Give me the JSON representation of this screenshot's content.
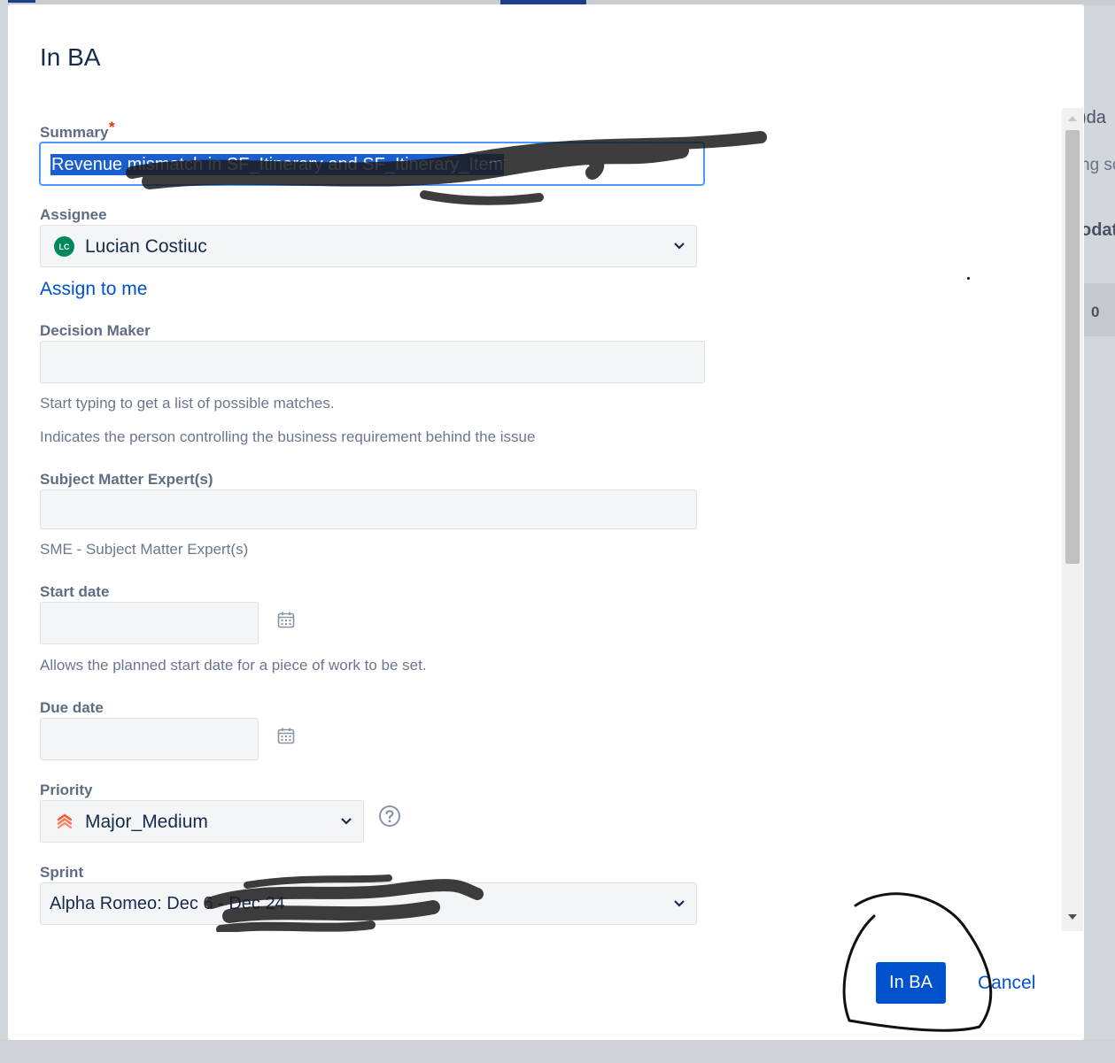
{
  "background": {
    "right_fragments": [
      ")da",
      "ng sc",
      "odat",
      "0"
    ]
  },
  "dialog": {
    "title": "In BA",
    "summary": {
      "label": "Summary",
      "required_mark": "*",
      "value": "Revenue mismatch in SF_Itinerary and SF_Itinerary_Item"
    },
    "assignee": {
      "label": "Assignee",
      "avatar_initials": "LC",
      "value": "Lucian Costiuc",
      "assign_to_me": "Assign to me"
    },
    "decision_maker": {
      "label": "Decision Maker",
      "value": "",
      "help1": "Start typing to get a list of possible matches.",
      "help2": "Indicates the person controlling the business requirement behind the issue"
    },
    "sme": {
      "label": "Subject Matter Expert(s)",
      "value": "",
      "help": "SME - Subject Matter Expert(s)"
    },
    "start_date": {
      "label": "Start date",
      "value": "",
      "help": "Allows the planned start date for a piece of work to be set."
    },
    "due_date": {
      "label": "Due date",
      "value": ""
    },
    "priority": {
      "label": "Priority",
      "value": "Major_Medium",
      "icon_color": "#ff5630"
    },
    "sprint": {
      "label": "Sprint",
      "value": "Alpha Romeo:  Dec 6 - Dec 24"
    },
    "footer": {
      "submit": "In BA",
      "cancel": "Cancel"
    }
  },
  "colors": {
    "primary": "#0052cc",
    "focus_border": "#4c9aff",
    "avatar": "#00875a",
    "required": "#de350b"
  }
}
